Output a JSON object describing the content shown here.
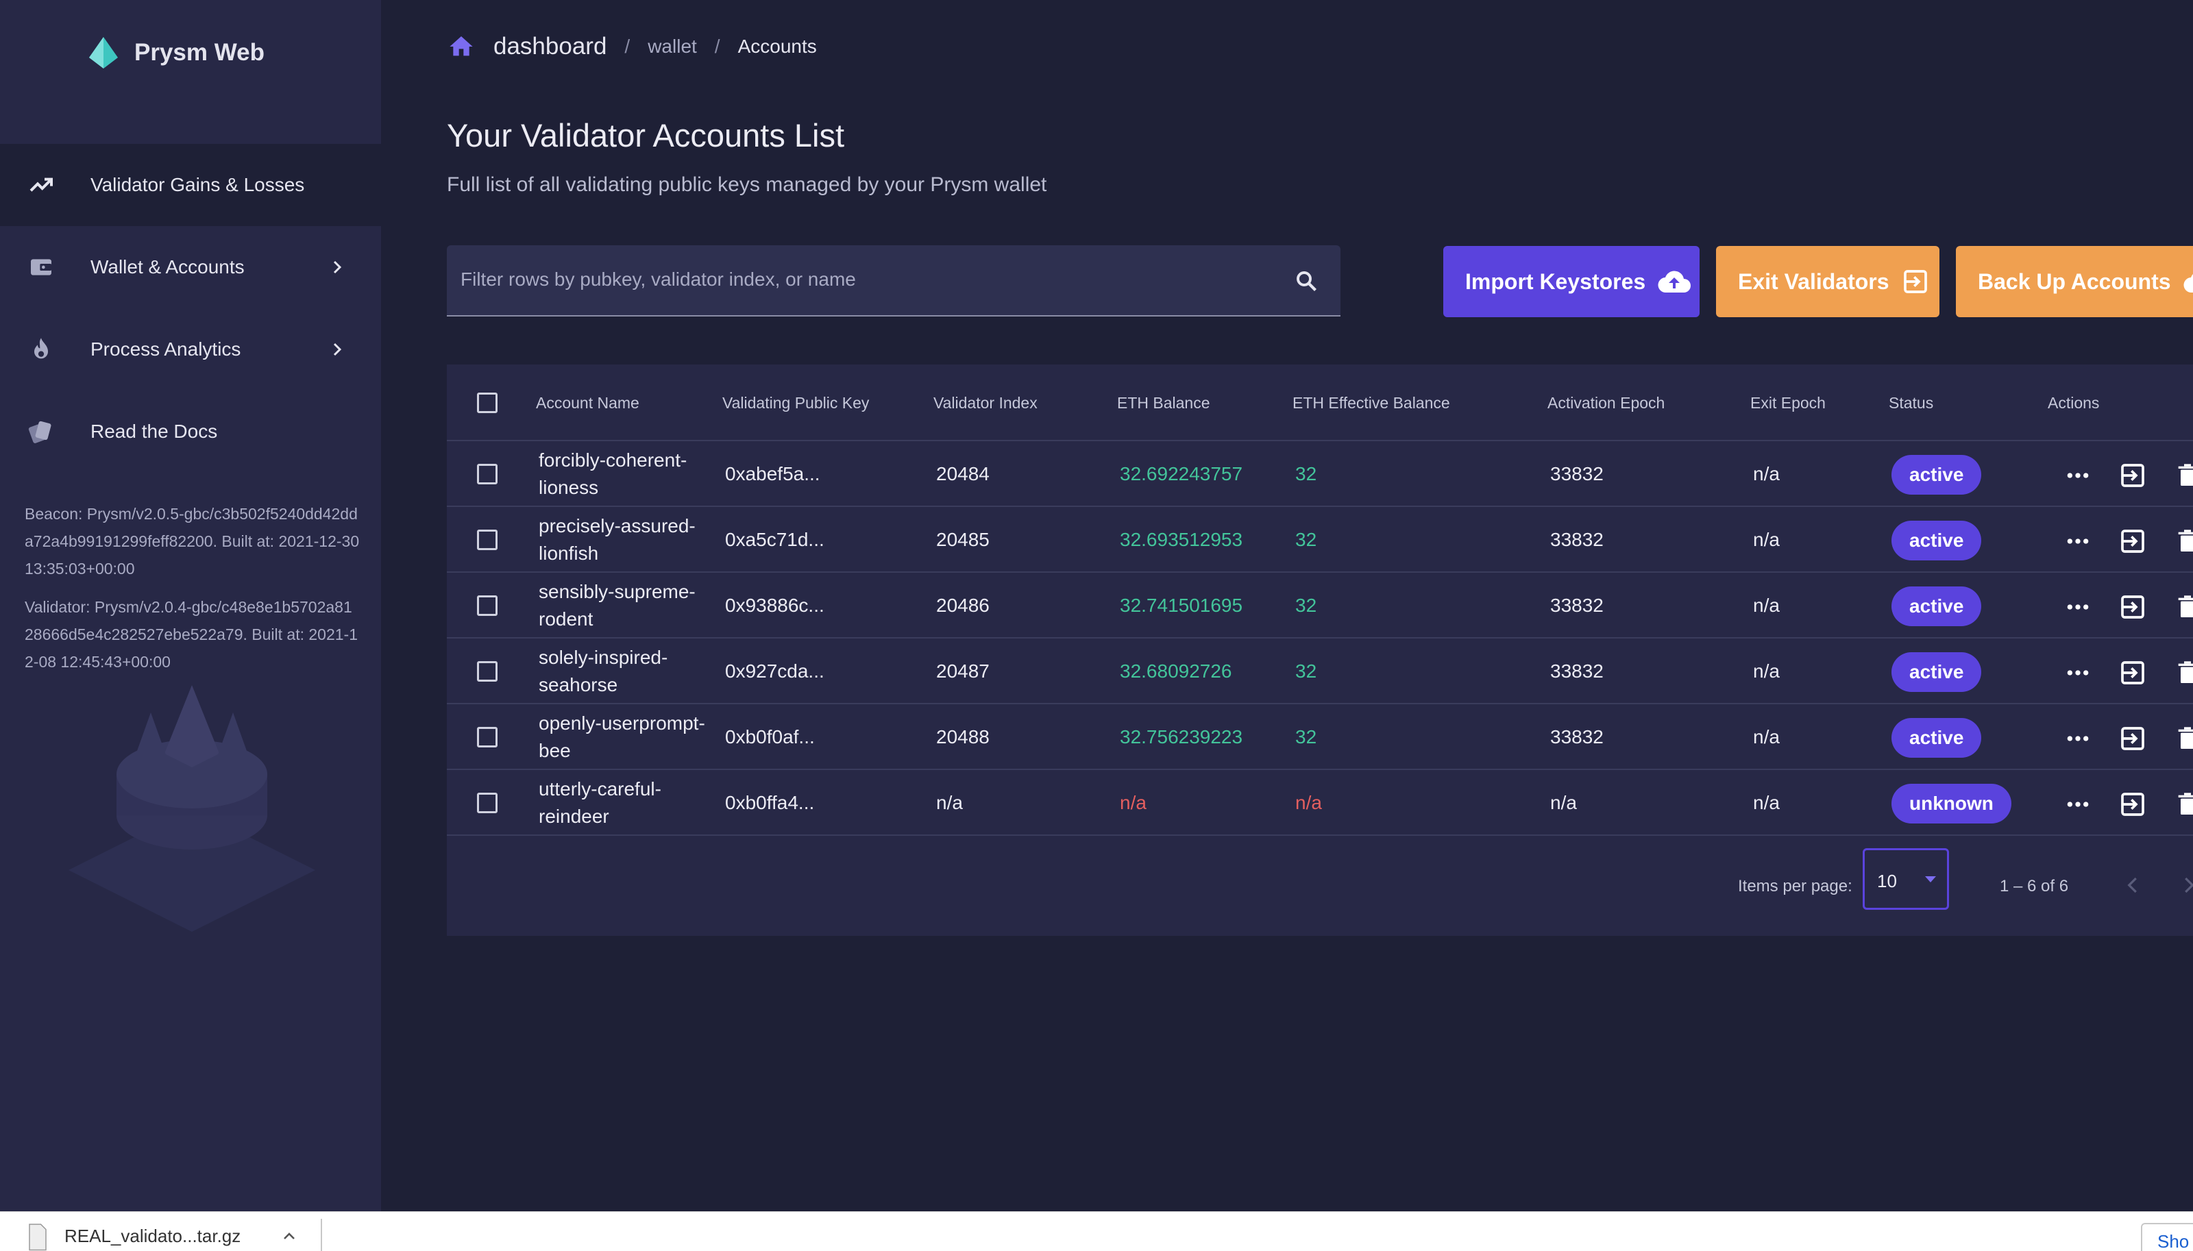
{
  "app": {
    "name": "Prysm Web",
    "accent": "#5a43dd",
    "warn": "#f0a050",
    "positive": "#43c49a",
    "negative": "#e45f5f"
  },
  "sidebar": {
    "items": [
      {
        "label": "Validator Gains & Losses",
        "icon": "trending-up-icon",
        "active": true
      },
      {
        "label": "Wallet & Accounts",
        "icon": "wallet-icon",
        "expandable": true
      },
      {
        "label": "Process Analytics",
        "icon": "flame-icon",
        "expandable": true
      },
      {
        "label": "Read the Docs",
        "icon": "docs-icon"
      }
    ],
    "beacon_version": "Beacon: Prysm/v2.0.5-gbc/c3b502f5240dd42dda72a4b99191299feff82200. Built at: 2021-12-30 13:35:03+00:00",
    "validator_version": "Validator: Prysm/v2.0.4-gbc/c48e8e1b5702a8128666d5e4c282527ebe522a79. Built at: 2021-12-08 12:45:43+00:00"
  },
  "breadcrumb": {
    "root": "dashboard",
    "items": [
      "wallet",
      "Accounts"
    ]
  },
  "page": {
    "title": "Your Validator Accounts List",
    "subtitle": "Full list of all validating public keys managed by your Prysm wallet"
  },
  "search": {
    "placeholder": "Filter rows by pubkey, validator index, or name",
    "value": ""
  },
  "buttons": {
    "import": "Import Keystores",
    "exit": "Exit Validators",
    "backup": "Back Up Accounts"
  },
  "table": {
    "headers": [
      "Account Name",
      "Validating Public Key",
      "Validator Index",
      "ETH Balance",
      "ETH Effective Balance",
      "Activation Epoch",
      "Exit Epoch",
      "Status",
      "Actions"
    ],
    "rows": [
      {
        "name_line1": "forcibly-coherent-",
        "name_line2": "lioness",
        "pubkey": "0xabef5a...",
        "index": "20484",
        "balance": "32.692243757",
        "effective": "32",
        "activation": "33832",
        "exit": "n/a",
        "status": "active"
      },
      {
        "name_line1": "precisely-assured-",
        "name_line2": "lionfish",
        "pubkey": "0xa5c71d...",
        "index": "20485",
        "balance": "32.693512953",
        "effective": "32",
        "activation": "33832",
        "exit": "n/a",
        "status": "active"
      },
      {
        "name_line1": "sensibly-supreme-",
        "name_line2": "rodent",
        "pubkey": "0x93886c...",
        "index": "20486",
        "balance": "32.741501695",
        "effective": "32",
        "activation": "33832",
        "exit": "n/a",
        "status": "active"
      },
      {
        "name_line1": "solely-inspired-",
        "name_line2": "seahorse",
        "pubkey": "0x927cda...",
        "index": "20487",
        "balance": "32.68092726",
        "effective": "32",
        "activation": "33832",
        "exit": "n/a",
        "status": "active"
      },
      {
        "name_line1": "openly-userprompt-",
        "name_line2": "bee",
        "pubkey": "0xb0f0af...",
        "index": "20488",
        "balance": "32.756239223",
        "effective": "32",
        "activation": "33832",
        "exit": "n/a",
        "status": "active"
      },
      {
        "name_line1": "utterly-careful-",
        "name_line2": "reindeer",
        "pubkey": "0xb0ffa4...",
        "index": "n/a",
        "balance": "n/a",
        "effective": "n/a",
        "activation": "n/a",
        "exit": "n/a",
        "status": "unknown"
      }
    ],
    "paginator": {
      "items_per_page_label": "Items per page:",
      "page_size": "10",
      "range": "1 – 6 of 6"
    }
  },
  "download_bar": {
    "file": "REAL_validato...tar.gz",
    "show_all": "Sho"
  }
}
